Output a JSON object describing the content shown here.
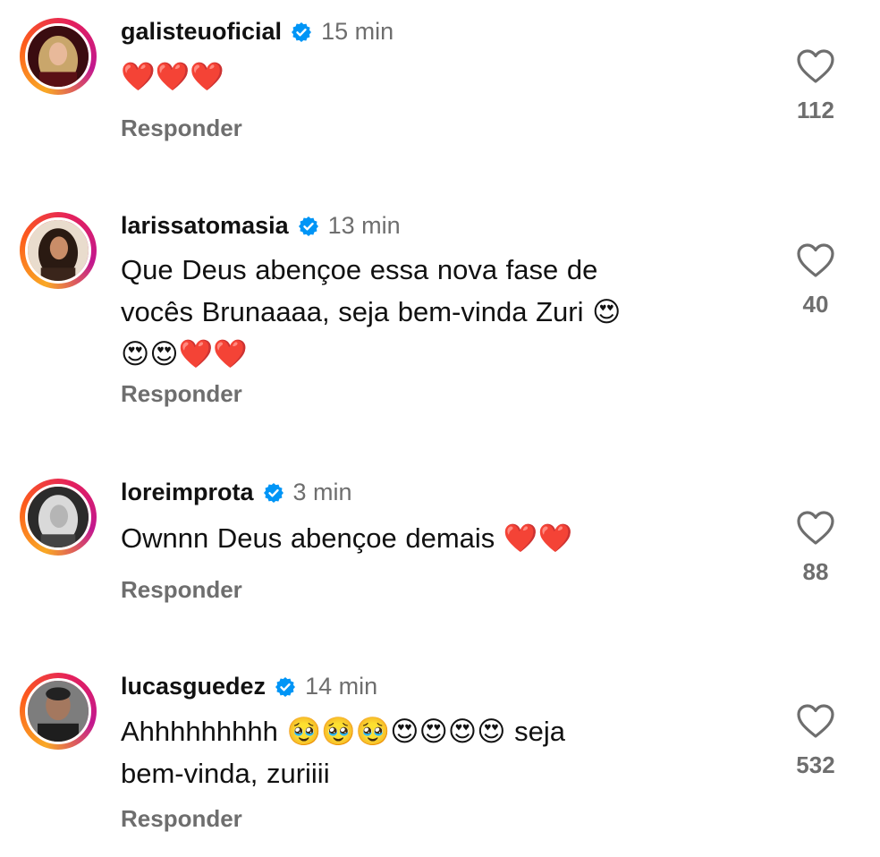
{
  "comments": [
    {
      "username": "galisteuoficial",
      "time": "15 min",
      "text": "❤️❤️❤️",
      "reply_label": "Responder",
      "likes": "112",
      "verified": true
    },
    {
      "username": "larissatomasia",
      "time": "13 min",
      "text": "Que Deus abençoe essa nova fase de\nvocês Brunaaaa, seja bem-vinda Zuri 😍\n😍😍❤️❤️",
      "reply_label": "Responder",
      "likes": "40",
      "verified": true
    },
    {
      "username": "loreimprota",
      "time": "3 min",
      "text": "Ownnn Deus abençoe demais ❤️❤️",
      "reply_label": "Responder",
      "likes": "88",
      "verified": true
    },
    {
      "username": "lucasguedez",
      "time": "14 min",
      "text": "Ahhhhhhhhh 🥹🥹🥹😍😍😍😍 seja\nbem-vinda, zuriiii",
      "reply_label": "Responder",
      "likes": "532",
      "verified": true
    }
  ],
  "icons": {
    "verified": "verified-badge-icon",
    "like": "heart-outline-icon"
  },
  "colors": {
    "verified_blue": "#0095f6",
    "secondary_text": "#6e6e6e",
    "primary_text": "#111111"
  }
}
